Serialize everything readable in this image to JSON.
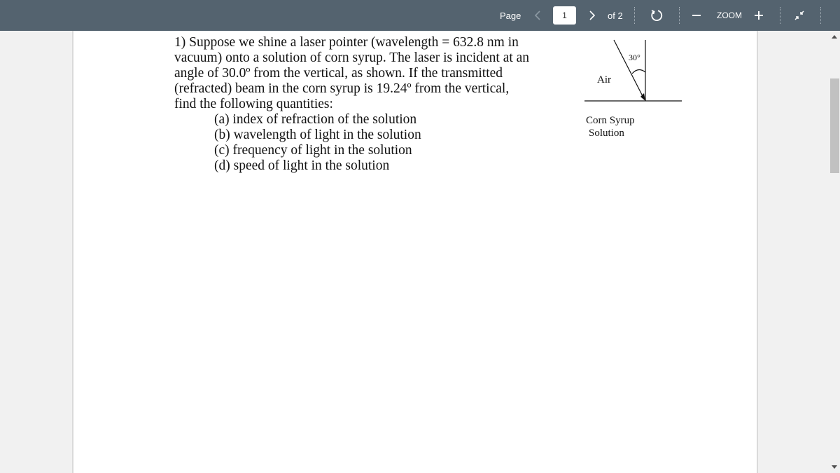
{
  "toolbar": {
    "page_label": "Page",
    "current_page": "1",
    "of_label": "of 2",
    "zoom_label": "ZOOM",
    "zoom_out_glyph": "—",
    "zoom_in_glyph": "+",
    "prev_glyph": "<",
    "next_glyph": ">",
    "icons": [
      "chevron-left-icon",
      "chevron-right-icon",
      "rotate-icon",
      "minus-icon",
      "plus-icon",
      "collapse-icon"
    ]
  },
  "document": {
    "question_lines": [
      "1) Suppose we shine a laser pointer (wavelength = 632.8 nm in",
      "vacuum) onto a solution of corn syrup. The laser is incident at an",
      "angle of 30.0º from the vertical, as shown. If the transmitted",
      "(refracted) beam in the corn syrup is 19.24º from the vertical,",
      "find the following quantities:"
    ],
    "sub_items": [
      "(a) index of refraction of the solution",
      "(b) wavelength of light in the solution",
      "(c) frequency of light in the solution",
      "(d) speed of light in the solution"
    ],
    "diagram": {
      "angle_label": "30°",
      "upper_medium": "Air",
      "lower_medium_line1": "Corn Syrup",
      "lower_medium_line2": "Solution"
    }
  }
}
